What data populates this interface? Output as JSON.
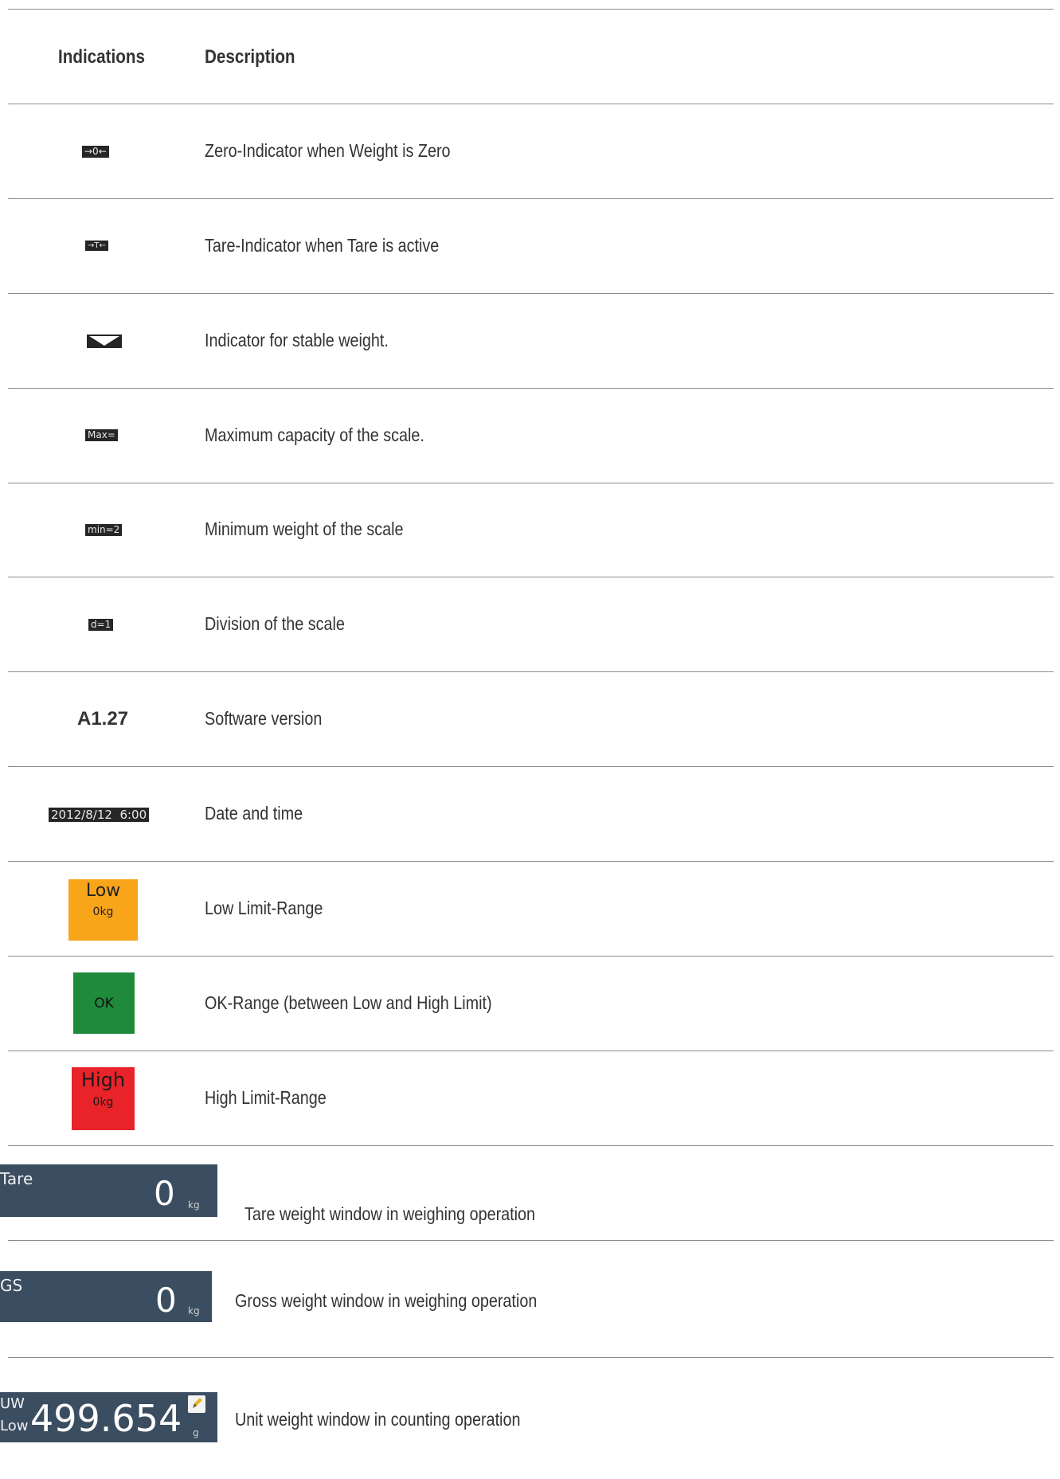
{
  "header": {
    "indications": "Indications",
    "description": "Description"
  },
  "rows": [
    {
      "indicator": "→0←",
      "description": "Zero-Indicator when Weight is Zero"
    },
    {
      "indicator": "→T←",
      "description": "Tare-Indicator when Tare is active"
    },
    {
      "indicator": "stable-weight-icon",
      "description": "Indicator for stable weight."
    },
    {
      "indicator": "Max=",
      "description": "Maximum capacity of the scale."
    },
    {
      "indicator": "min=2",
      "description": "Minimum weight of the scale"
    },
    {
      "indicator": "d=1",
      "description": "Division of the scale"
    },
    {
      "indicator": "A1.27",
      "description": "Software version"
    },
    {
      "indicator": "2012/8/12  6:00",
      "description": "Date and time"
    },
    {
      "indicator_title": "Low",
      "indicator_value": "0kg",
      "color": "#f9a51a",
      "description": "Low Limit-Range"
    },
    {
      "indicator_title": "OK",
      "color": "#1f8a3b",
      "description": "OK-Range (between Low and High Limit)"
    },
    {
      "indicator_title": "High",
      "indicator_value": "0kg",
      "color": "#e8232a",
      "description": "High Limit-Range"
    }
  ],
  "windows": [
    {
      "label": "Tare",
      "value": "0",
      "unit": "kg",
      "description": "Tare weight window in weighing operation"
    },
    {
      "label": "GS",
      "value": "0",
      "unit": "kg",
      "description": "Gross weight window in weighing operation"
    },
    {
      "label_top": "UW",
      "label_bottom": "Low",
      "value": "499.654",
      "unit": "g",
      "description": "Unit weight window in counting operation"
    }
  ]
}
